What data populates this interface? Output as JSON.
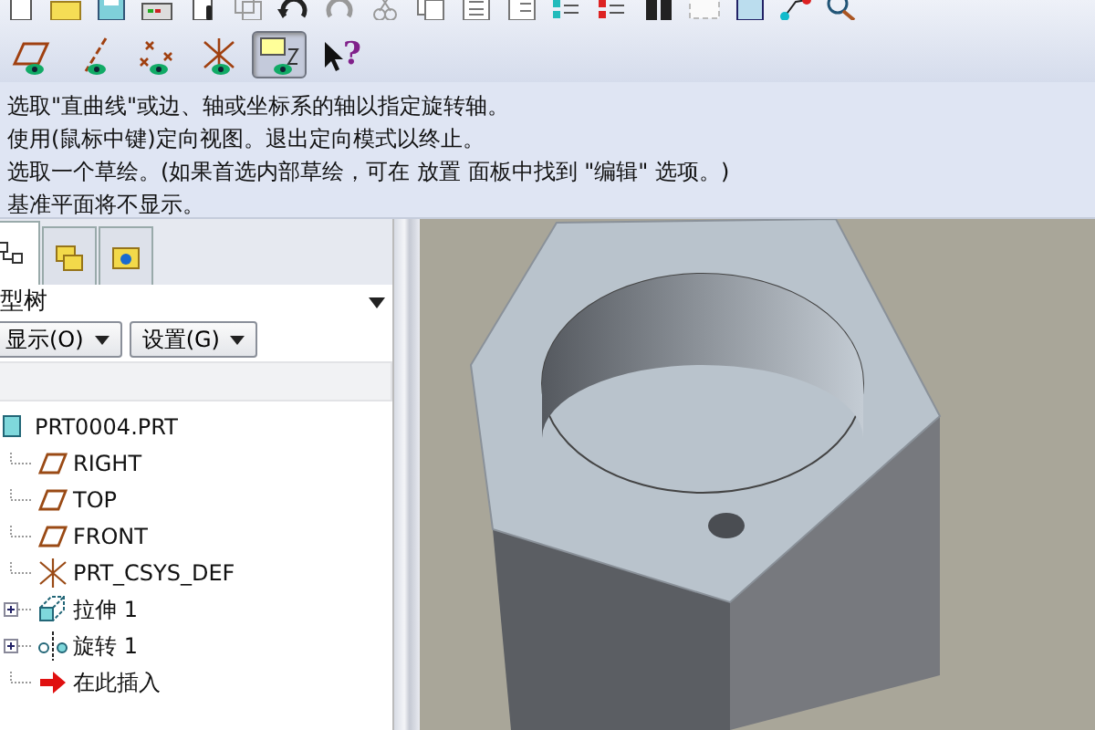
{
  "toolbar": {
    "display_toggles": [
      {
        "kind": "plane",
        "selected": false
      },
      {
        "kind": "axis",
        "selected": false
      },
      {
        "kind": "point",
        "selected": false
      },
      {
        "kind": "csys",
        "selected": false
      },
      {
        "kind": "annotation",
        "selected": true
      }
    ],
    "help_label": "?"
  },
  "messages": [
    "选取\"直曲线\"或边、轴或坐标系的轴以指定旋转轴。",
    "使用(鼠标中键)定向视图。退出定向模式以终止。",
    "选取一个草绘。(如果首选内部草绘，可在 放置 面板中找到 \"编辑\" 选项。)",
    "基准平面将不显示。"
  ],
  "panel": {
    "tabs": [
      {
        "kind": "tree",
        "selected": true
      },
      {
        "kind": "folders",
        "selected": false
      },
      {
        "kind": "favorites",
        "selected": false
      }
    ],
    "title": "型树",
    "buttons": [
      {
        "label": "显示(O)"
      },
      {
        "label": "设置(G)"
      }
    ],
    "tree": [
      {
        "label": "PRT0004.PRT",
        "kind": "part",
        "children": [
          {
            "label": "RIGHT",
            "kind": "plane",
            "expandable": false
          },
          {
            "label": "TOP",
            "kind": "plane",
            "expandable": false
          },
          {
            "label": "FRONT",
            "kind": "plane",
            "expandable": false
          },
          {
            "label": "PRT_CSYS_DEF",
            "kind": "csys",
            "expandable": false
          },
          {
            "label": "拉伸 1",
            "kind": "extrude",
            "expandable": true
          },
          {
            "label": "旋转 1",
            "kind": "revolve",
            "expandable": true
          },
          {
            "label": "在此插入",
            "kind": "insert",
            "expandable": false
          }
        ]
      }
    ]
  }
}
